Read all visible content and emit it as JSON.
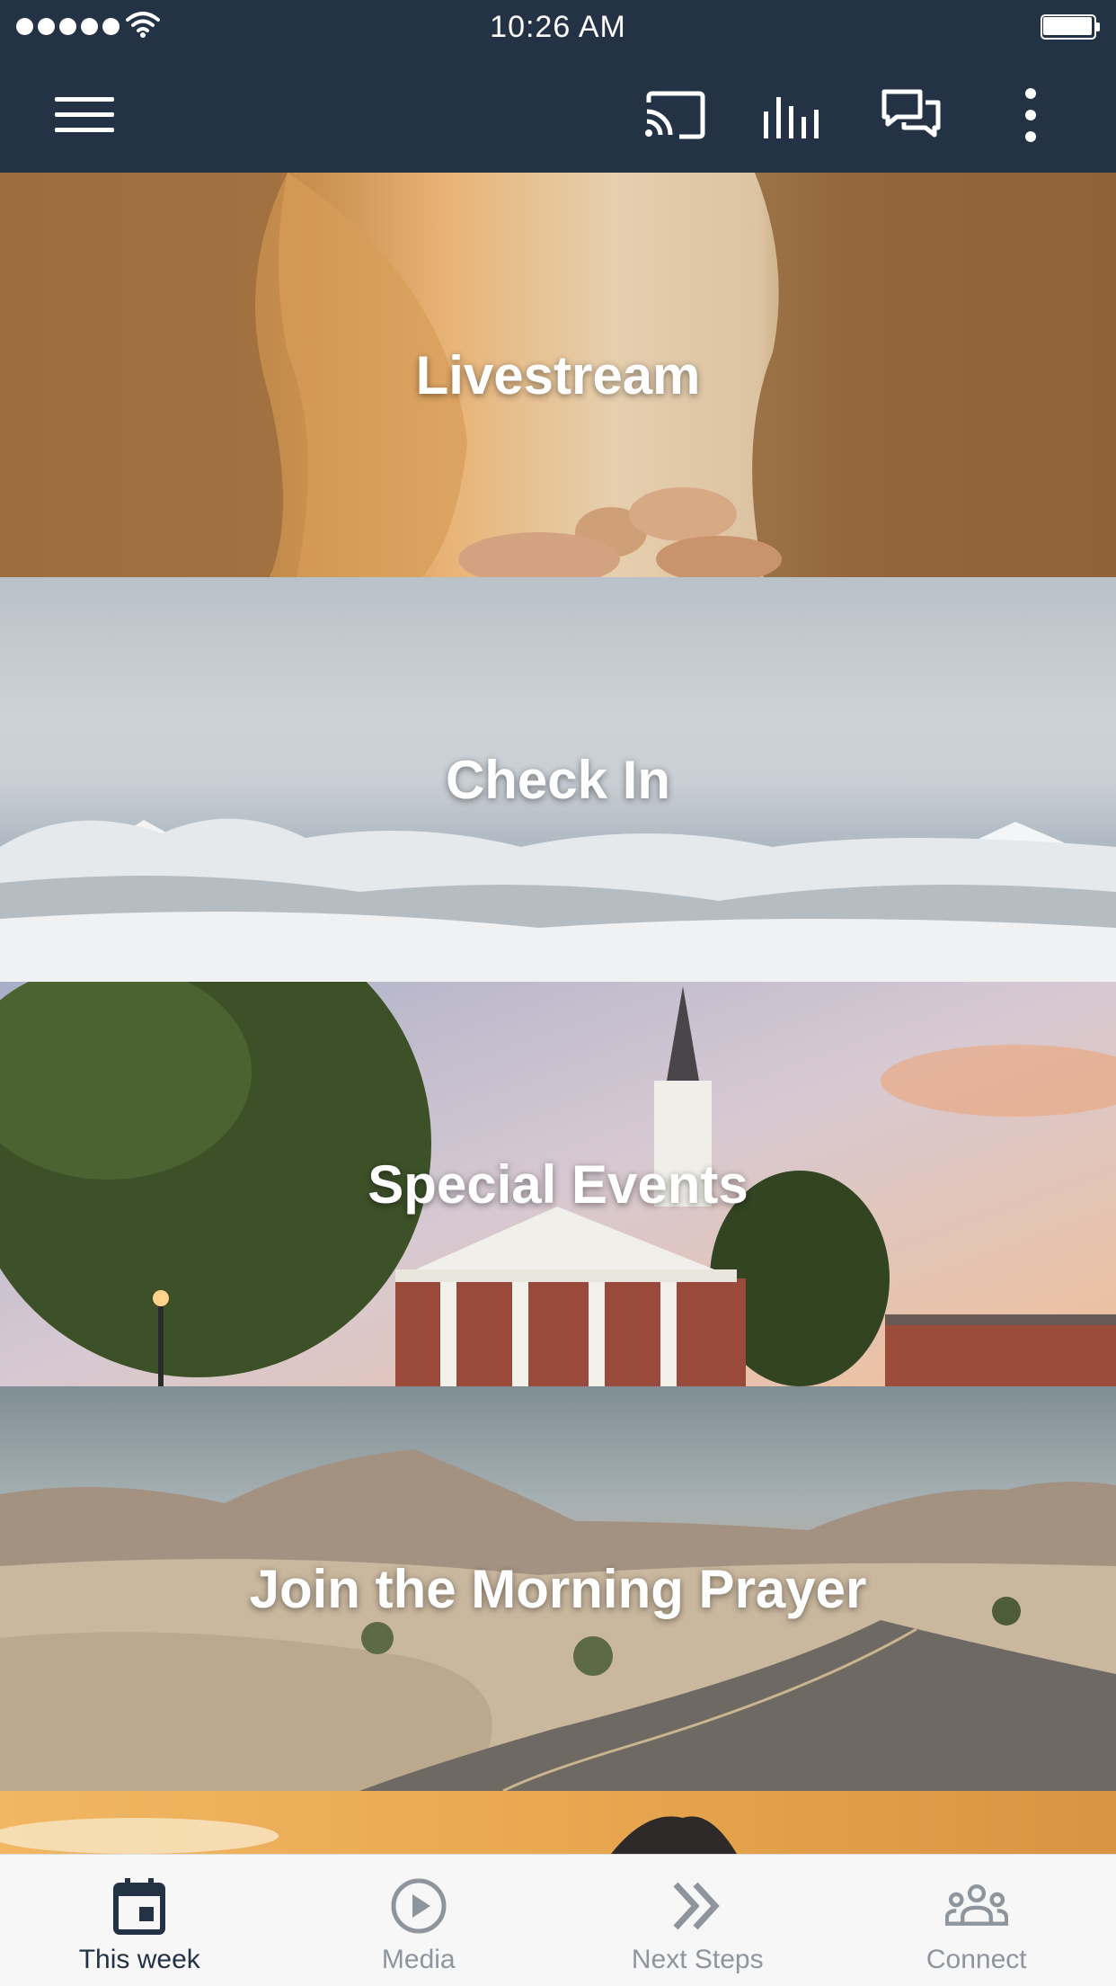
{
  "status_bar": {
    "time": "10:26 AM"
  },
  "app_bar": {
    "icons": [
      "menu-icon",
      "cast-icon",
      "equalizer-icon",
      "chat-icon",
      "more-vert-icon"
    ]
  },
  "feed": {
    "cards": [
      {
        "title": "Livestream"
      },
      {
        "title": "Check In"
      },
      {
        "title": "Special Events"
      },
      {
        "title": "Join the Morning Prayer"
      }
    ]
  },
  "tab_bar": {
    "active_color": "#243246",
    "inactive_color": "#8e959d",
    "tabs": [
      {
        "label": "This week",
        "icon": "calendar-icon",
        "active": true
      },
      {
        "label": "Media",
        "icon": "play-circle-icon",
        "active": false
      },
      {
        "label": "Next Steps",
        "icon": "double-chevron-icon",
        "active": false
      },
      {
        "label": "Connect",
        "icon": "group-icon",
        "active": false
      }
    ]
  },
  "colors": {
    "header": "#243246"
  }
}
